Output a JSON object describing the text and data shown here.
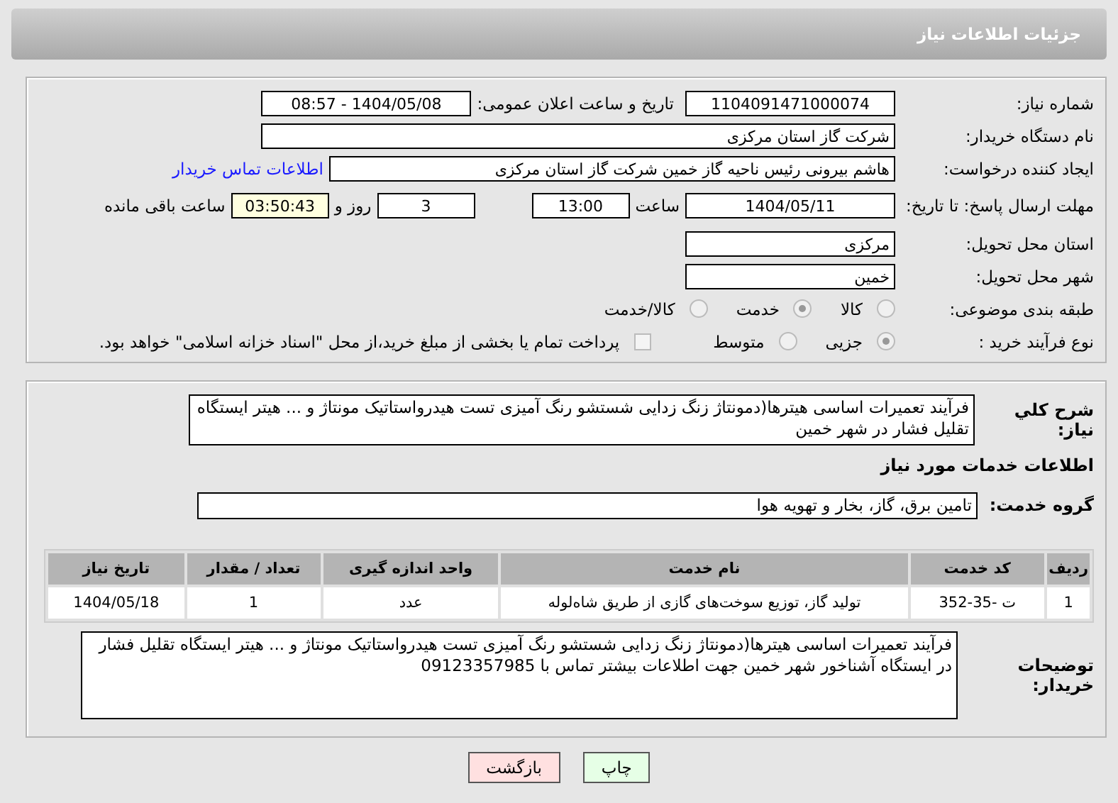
{
  "header": {
    "title": "جزئیات اطلاعات نیاز"
  },
  "need_info": {
    "need_number": {
      "label": "شماره نیاز:",
      "value": "1104091471000074"
    },
    "announce": {
      "label": "تاریخ و ساعت اعلان عمومی:",
      "value": "1404/05/08 - 08:57"
    },
    "buyer_org": {
      "label": "نام دستگاه خریدار:",
      "value": "شرکت گاز استان مرکزی"
    },
    "creator": {
      "label": "ایجاد کننده درخواست:",
      "value": "هاشم بیرونی رئیس ناحیه گاز خمین شرکت گاز استان مرکزی",
      "link": "اطلاعات تماس خریدار"
    },
    "deadline": {
      "label": "مهلت ارسال پاسخ: تا تاریخ:",
      "date": "1404/05/11",
      "time_label": "ساعت",
      "time": "13:00",
      "days": "3",
      "days_label": "روز و",
      "remaining": "03:50:43",
      "remaining_label": "ساعت باقی مانده"
    },
    "province": {
      "label": "استان محل تحویل:",
      "value": "مرکزی"
    },
    "city": {
      "label": "شهر محل تحویل:",
      "value": "خمین"
    },
    "category": {
      "label": "طبقه بندی موضوعی:",
      "options": [
        {
          "label": "کالا",
          "selected": false
        },
        {
          "label": "خدمت",
          "selected": true
        },
        {
          "label": "کالا/خدمت",
          "selected": false
        }
      ]
    },
    "process": {
      "label": "نوع فرآیند خرید :",
      "options": [
        {
          "label": "جزیی",
          "selected": true
        },
        {
          "label": "متوسط",
          "selected": false
        }
      ],
      "payment": {
        "label": "پرداخت تمام یا بخشی از مبلغ خرید،از محل \"اسناد خزانه اسلامی\" خواهد بود.",
        "checked": false
      }
    }
  },
  "services": {
    "summary": {
      "label": "شرح کلي نياز:",
      "value": "فرآیند تعمیرات اساسی هیترها(دمونتاژ زنگ زدایی شستشو رنگ آمیزی تست هیدرواستاتیک مونتاژ و ... هیتر ایستگاه تقلیل فشار در شهر خمین"
    },
    "heading": "اطلاعات خدمات مورد نیاز",
    "group": {
      "label": "گروه خدمت:",
      "value": "تامین برق، گاز، بخار و تهویه هوا"
    },
    "table": {
      "columns": [
        "ردیف",
        "کد خدمت",
        "نام خدمت",
        "واحد اندازه گیری",
        "تعداد / مقدار",
        "تاریخ نیاز"
      ],
      "rows": [
        [
          "1",
          "ت -35-352",
          "تولید گاز، توزیع سوخت‌های گازی از طریق شاه‌لوله",
          "عدد",
          "1",
          "1404/05/18"
        ]
      ]
    },
    "buyer_notes": {
      "label": "توضیحات خریدار:",
      "value": "فرآیند تعمیرات اساسی هیترها(دمونتاژ زنگ زدایی شستشو رنگ آمیزی تست هیدرواستاتیک مونتاژ و ... هیتر ایستگاه تقلیل فشار در ایستگاه آشناخور شهر خمین جهت اطلاعات بیشتر تماس با 09123357985"
    }
  },
  "buttons": [
    {
      "label": "چاپ",
      "kind": "print"
    },
    {
      "label": "بازگشت",
      "kind": "back"
    }
  ]
}
